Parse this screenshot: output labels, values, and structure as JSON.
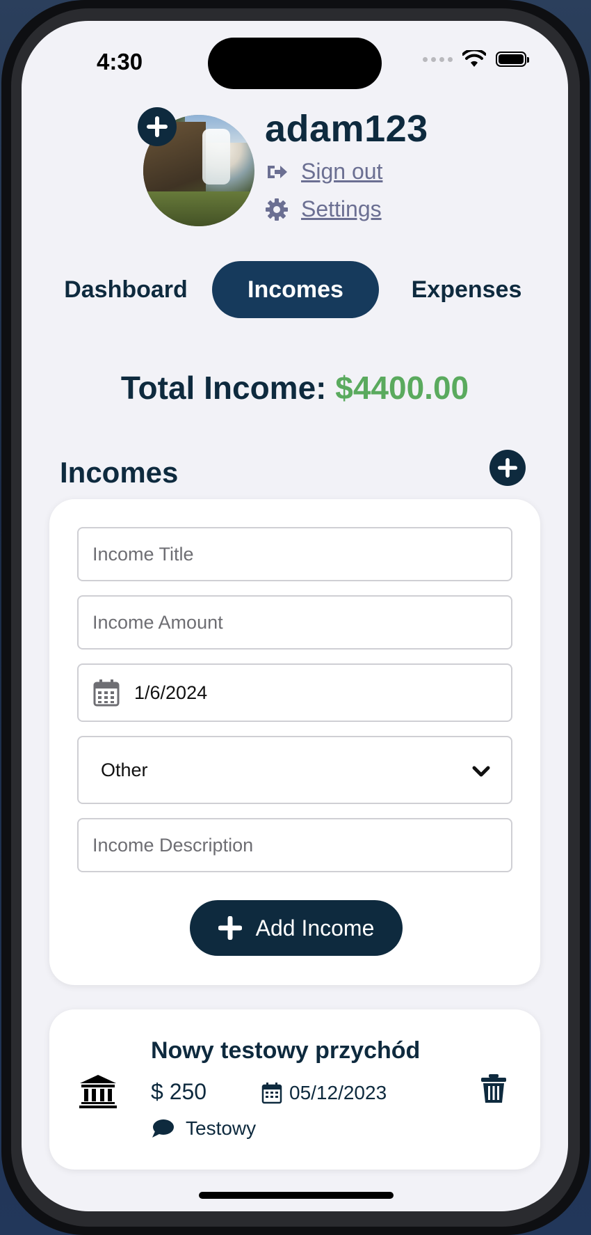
{
  "status_bar": {
    "time": "4:30"
  },
  "profile": {
    "username": "adam123",
    "signout_label": "Sign out",
    "settings_label": "Settings"
  },
  "tabs": [
    {
      "label": "Dashboard",
      "active": false
    },
    {
      "label": "Incomes",
      "active": true
    },
    {
      "label": "Expenses",
      "active": false
    }
  ],
  "total": {
    "label": "Total Income:",
    "amount": "$4400.00"
  },
  "incomes_section": {
    "title": "Incomes"
  },
  "form": {
    "title_placeholder": "Income Title",
    "amount_placeholder": "Income Amount",
    "date_value": "1/6/2024",
    "category_value": "Other",
    "description_placeholder": "Income Description",
    "add_button_label": "Add Income"
  },
  "income_items": [
    {
      "title": "Nowy testowy przychód",
      "amount": "$ 250",
      "date": "05/12/2023",
      "description": "Testowy",
      "icon": "bank-icon"
    }
  ],
  "colors": {
    "primary": "#0e2a3e",
    "active_tab": "#163a5c",
    "income_green": "#5aaa5e",
    "link": "#6b6f92",
    "background": "#f2f2f7"
  }
}
